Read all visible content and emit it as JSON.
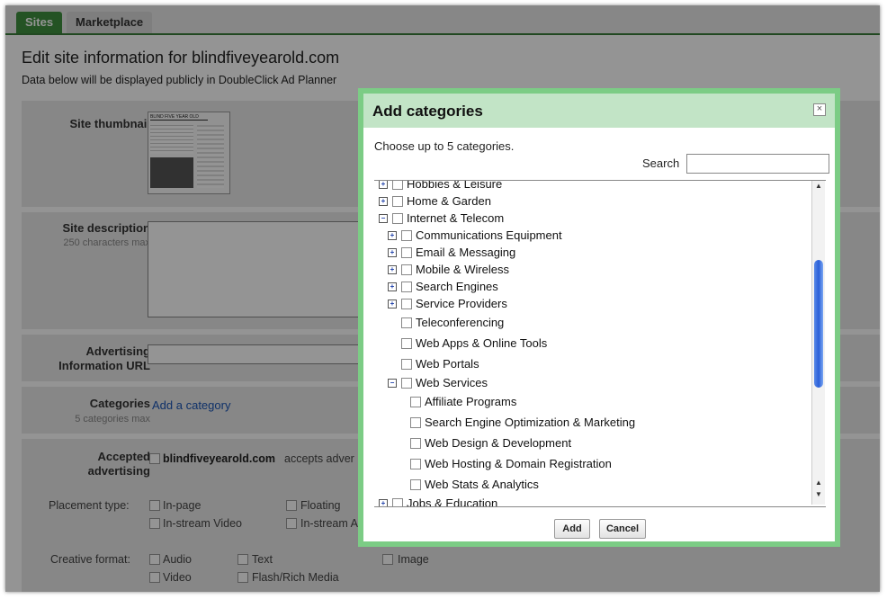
{
  "tabs": [
    {
      "label": "Sites"
    },
    {
      "label": "Marketplace"
    }
  ],
  "page": {
    "title": "Edit site information for blindfiveyearold.com",
    "subtitle": "Data below will be displayed publicly in DoubleClick Ad Planner"
  },
  "form": {
    "thumbnail_label": "Site thumbnail",
    "thumbnail_caption": "BLIND FIVE YEAR OLD",
    "description_label": "Site description",
    "description_hint": "250 characters max",
    "url_label": "Advertising Information URL",
    "categories_label": "Categories",
    "categories_hint": "5 categories max",
    "add_category_link": "Add a category",
    "accepted_label": "Accepted advertising",
    "accepted_site": "blindfiveyearold.com",
    "accepted_text": "accepts adver",
    "placement_label": "Placement type:",
    "placement_options": [
      "In-page",
      "Floating",
      "In-stream Video",
      "In-stream Au"
    ],
    "creative_label": "Creative format:",
    "creative_options": [
      "Audio",
      "Text",
      "Image",
      "Video",
      "Flash/Rich Media"
    ]
  },
  "dialog": {
    "title": "Add categories",
    "close_glyph": "×",
    "instructions": "Choose up to 5 categories.",
    "search_label": "Search",
    "search_value": "",
    "tree": [
      {
        "label": "Hobbies & Leisure",
        "expander": "+"
      },
      {
        "label": "Home & Garden",
        "expander": "+"
      },
      {
        "label": "Internet & Telecom",
        "expander": "−"
      },
      {
        "label": "Communications Equipment",
        "expander": "+"
      },
      {
        "label": "Email & Messaging",
        "expander": "+"
      },
      {
        "label": "Mobile & Wireless",
        "expander": "+"
      },
      {
        "label": "Search Engines",
        "expander": "+"
      },
      {
        "label": "Service Providers",
        "expander": "+"
      },
      {
        "label": "Teleconferencing",
        "expander": ""
      },
      {
        "label": "Web Apps & Online Tools",
        "expander": ""
      },
      {
        "label": "Web Portals",
        "expander": ""
      },
      {
        "label": "Web Services",
        "expander": "−"
      },
      {
        "label": "Affiliate Programs",
        "expander": ""
      },
      {
        "label": "Search Engine Optimization & Marketing",
        "expander": ""
      },
      {
        "label": "Web Design & Development",
        "expander": ""
      },
      {
        "label": "Web Hosting & Domain Registration",
        "expander": ""
      },
      {
        "label": "Web Stats & Analytics",
        "expander": ""
      },
      {
        "label": "Jobs & Education",
        "expander": "+"
      }
    ],
    "add_button": "Add",
    "cancel_button": "Cancel"
  },
  "colors": {
    "accent": "#3f8f3f",
    "dialog_border": "#7ccc85",
    "dialog_header": "#c2e4c6",
    "link": "#1a55b5"
  }
}
